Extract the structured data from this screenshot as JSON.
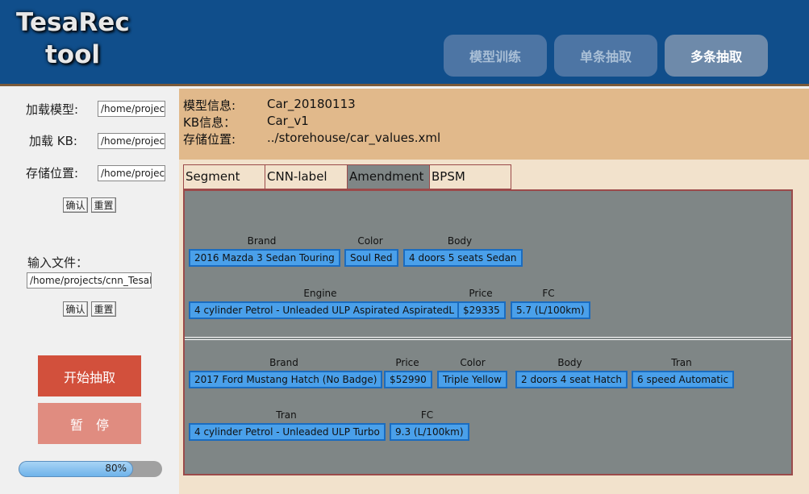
{
  "app": {
    "logo_line1": "TesaRec",
    "logo_line2": "tool"
  },
  "nav": {
    "train_label": "模型训练",
    "single_label": "单条抽取",
    "multi_label": "多条抽取"
  },
  "left": {
    "load_model_label": "加载模型:",
    "load_model_value": "/home/projects",
    "load_kb_label": "加载 KB:",
    "load_kb_value": "/home/projects",
    "save_loc_label": "存储位置:",
    "save_loc_value": "/home/projects",
    "confirm_label": "确认",
    "reset_label": "重置",
    "input_file_label": "输入文件：",
    "input_file_value": "/home/projects/cnn_TesaRec",
    "confirm2_label": "确认",
    "reset2_label": "重置",
    "start_label": "开始抽取",
    "pause_label": "暂　停",
    "progress_percent": 80,
    "progress_text": "80%"
  },
  "info": {
    "model_key": "模型信息:",
    "model_value": "Car_20180113",
    "kb_key": "KB信息：",
    "kb_value": "Car_v1",
    "store_key": "存储位置:",
    "store_value": "../storehouse/car_values.xml"
  },
  "tabs": [
    "Segment",
    "CNN-label",
    "Amendment",
    "BPSM"
  ],
  "records": [
    {
      "rows": [
        [
          {
            "label": "Brand",
            "value": "2016 Mazda 3 Sedan Touring"
          },
          {
            "label": "Color",
            "value": "Soul Red"
          },
          {
            "label": "Body",
            "value": "4 doors 5 seats Sedan"
          }
        ],
        [
          {
            "label": "Engine",
            "value": "4 cylinder Petrol - Unleaded ULP Aspirated AspiratedL"
          },
          {
            "label": "Price",
            "value": "$29335"
          },
          {
            "label": "FC",
            "value": "5.7 (L/100km)"
          }
        ]
      ]
    },
    {
      "rows": [
        [
          {
            "label": "Brand",
            "value": "2017 Ford Mustang Hatch (No Badge)"
          },
          {
            "label": "Price",
            "value": "$52990"
          },
          {
            "label": "Color",
            "value": "Triple Yellow"
          },
          {
            "label": "Body",
            "value": "2 doors 4 seat Hatch"
          },
          {
            "label": "Tran",
            "value": "6 speed Automatic"
          }
        ],
        [
          {
            "label": "Tran",
            "value": "4 cylinder Petrol - Unleaded ULP Turbo"
          },
          {
            "label": "FC",
            "value": "9.3 (L/100km)"
          }
        ]
      ]
    }
  ],
  "colors": {
    "header": "#104e8b",
    "start_button": "#d2503c",
    "pause_button": "#e08c80",
    "chip": "#4aa0ea",
    "info_bar": "#e1b98b"
  }
}
